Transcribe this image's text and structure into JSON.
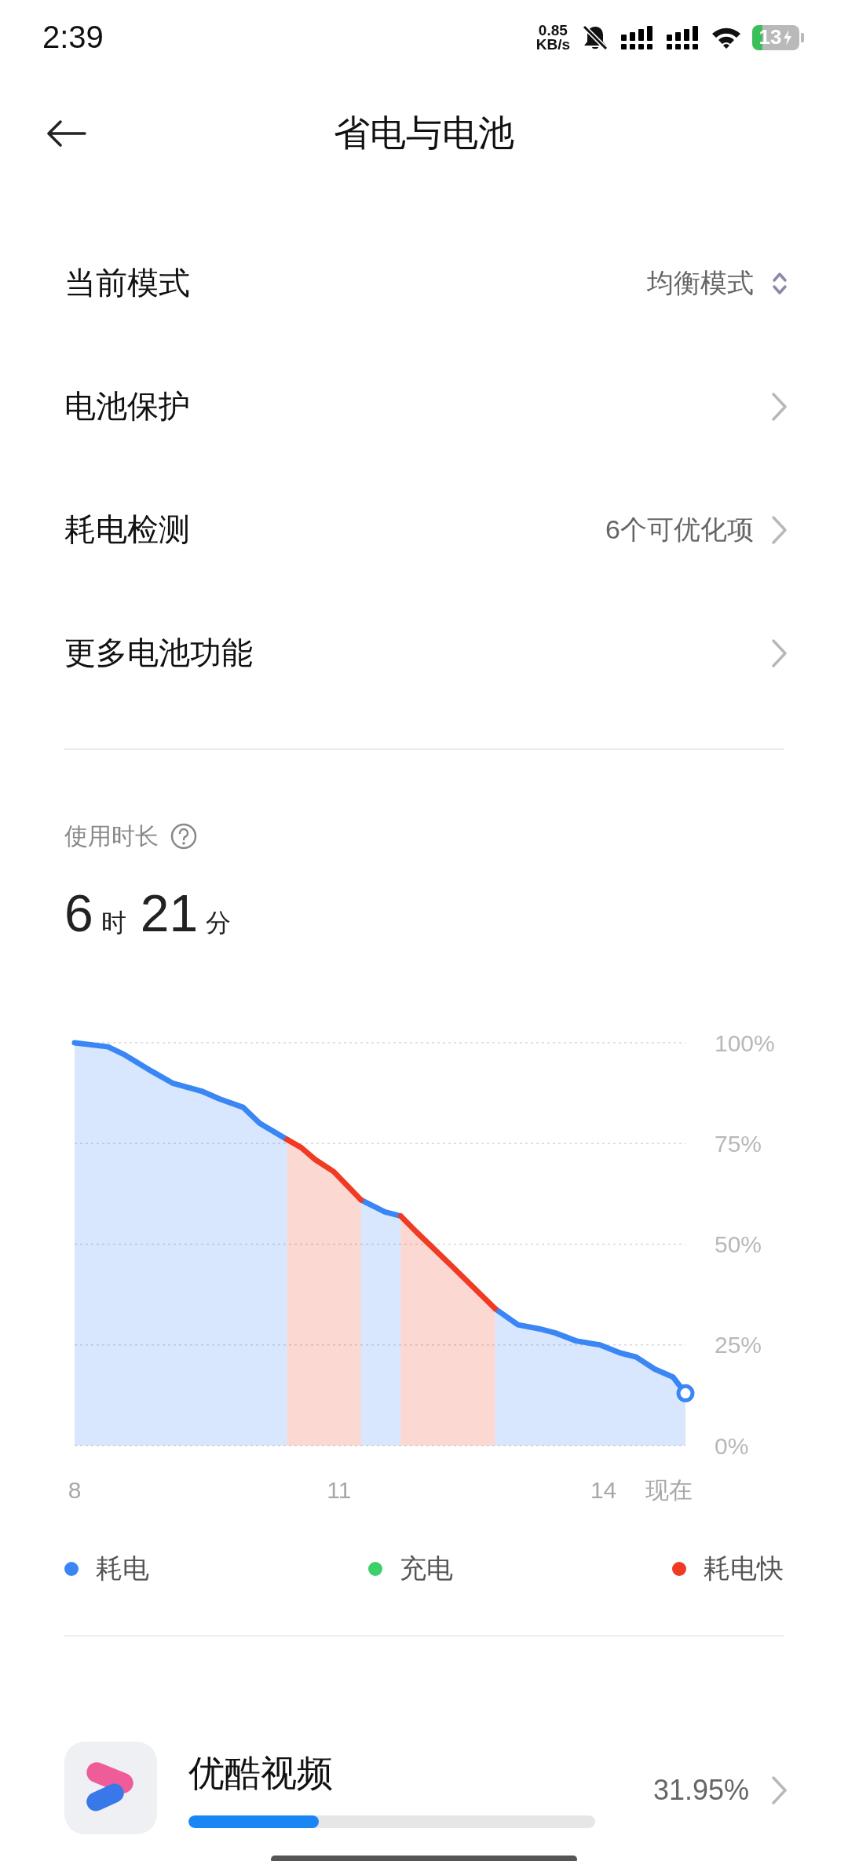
{
  "status_bar": {
    "time": "2:39",
    "net_speed_value": "0.85",
    "net_speed_unit": "KB/s",
    "battery": "13"
  },
  "header": {
    "title": "省电与电池"
  },
  "settings": [
    {
      "label": "当前模式",
      "value": "均衡模式",
      "kind": "select"
    },
    {
      "label": "电池保护",
      "kind": "link"
    },
    {
      "label": "耗电检测",
      "value": "6个可优化项",
      "kind": "link"
    },
    {
      "label": "更多电池功能",
      "kind": "link"
    }
  ],
  "usage": {
    "label": "使用时长",
    "duration": [
      {
        "value": "6",
        "unit": "时"
      },
      {
        "value": "21",
        "unit": "分"
      }
    ]
  },
  "chart": {
    "now_label": "现在",
    "chart_data": {
      "type": "area",
      "grid": true,
      "x": [
        8,
        8.38,
        8.57,
        8.87,
        9.11,
        9.44,
        9.65,
        9.91,
        10.1,
        10.41,
        10.57,
        10.73,
        10.94,
        11.25,
        11.52,
        11.7,
        11.88,
        12.26,
        12.77,
        13.03,
        13.27,
        13.45,
        13.69,
        13.96,
        14.19,
        14.37,
        14.58,
        14.79,
        14.93
      ],
      "series": [
        {
          "name": "耗电",
          "color": "#3a86f5",
          "values": [
            100,
            99,
            97,
            93,
            90,
            88,
            86,
            84,
            80,
            76,
            null,
            null,
            null,
            61,
            58,
            57,
            null,
            null,
            34,
            30,
            29,
            28,
            26,
            25,
            23,
            22,
            19,
            17,
            13
          ]
        },
        {
          "name": "充电",
          "color": "#3ccf6a",
          "values": [
            null,
            null,
            null,
            null,
            null,
            null,
            null,
            null,
            null,
            null,
            null,
            null,
            null,
            null,
            null,
            null,
            null,
            null,
            null,
            null,
            null,
            null,
            null,
            null,
            null,
            null,
            null,
            null,
            null
          ]
        },
        {
          "name": "耗电快",
          "color": "#f03a24",
          "values": [
            null,
            null,
            null,
            null,
            null,
            null,
            null,
            null,
            null,
            76,
            74,
            71,
            68,
            61,
            null,
            57,
            53,
            45,
            34,
            null,
            null,
            null,
            null,
            null,
            null,
            null,
            null,
            null,
            null
          ]
        }
      ],
      "xlim": [
        8,
        14.93
      ],
      "ylim": [
        0,
        100
      ],
      "xticks": [
        {
          "value": 8,
          "label": "8"
        },
        {
          "value": 11,
          "label": "11"
        },
        {
          "value": 14,
          "label": "14"
        }
      ],
      "yticks": [
        {
          "value": 100,
          "label": "100%"
        },
        {
          "value": 75,
          "label": "75%"
        },
        {
          "value": 50,
          "label": "50%"
        },
        {
          "value": 25,
          "label": "25%"
        },
        {
          "value": 0,
          "label": "0%"
        }
      ]
    }
  },
  "apps": [
    {
      "name": "优酷视频",
      "share": "31.95%",
      "level": 0.32
    }
  ]
}
